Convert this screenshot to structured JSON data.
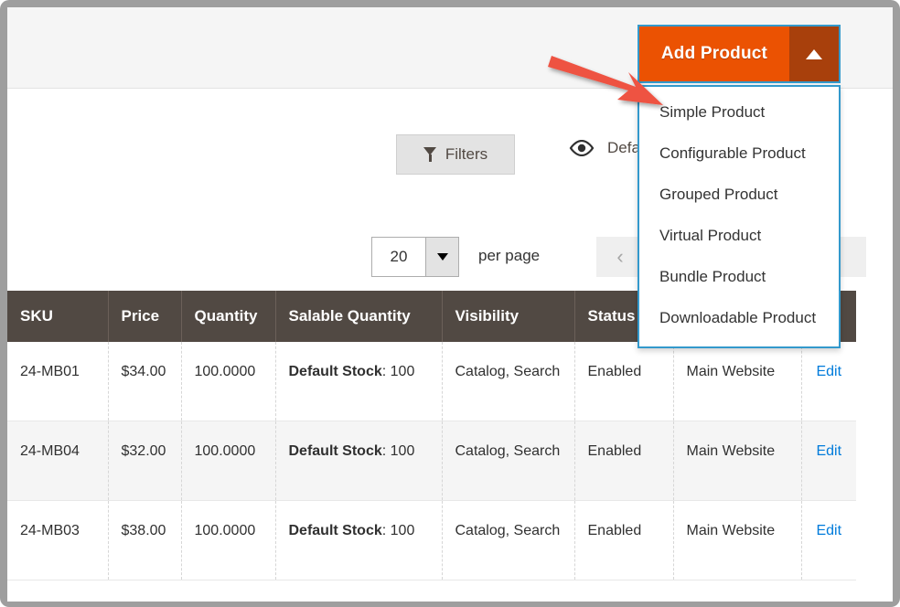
{
  "add_product": {
    "button_label": "Add Product",
    "toggle_icon": "caret-up-icon",
    "accent_color": "#eb5202",
    "toggle_color": "#a8400c",
    "focus_outline_color": "#3399cc",
    "menu_items": [
      {
        "label": "Simple Product"
      },
      {
        "label": "Configurable Product"
      },
      {
        "label": "Grouped Product"
      },
      {
        "label": "Virtual Product"
      },
      {
        "label": "Bundle Product"
      },
      {
        "label": "Downloadable Product"
      }
    ]
  },
  "toolbar": {
    "filters_label": "Filters",
    "filters_icon": "funnel-icon",
    "view_icon": "eye-icon",
    "view_label": "Default V"
  },
  "pager": {
    "per_page_value": "20",
    "per_page_label": "per page",
    "prev_label": "‹",
    "caret_icon": "chevron-down-icon"
  },
  "grid": {
    "columns": [
      "SKU",
      "Price",
      "Quantity",
      "Salable Quantity",
      "Visibility",
      "Status",
      "",
      ""
    ],
    "rows": [
      {
        "sku": "24-MB01",
        "price": "$34.00",
        "quantity": "100.0000",
        "salable_label": "Default Stock",
        "salable_value": ": 100",
        "visibility": "Catalog, Search",
        "status": "Enabled",
        "websites": "Main Website",
        "action": "Edit"
      },
      {
        "sku": "24-MB04",
        "price": "$32.00",
        "quantity": "100.0000",
        "salable_label": "Default Stock",
        "salable_value": ": 100",
        "visibility": "Catalog, Search",
        "status": "Enabled",
        "websites": "Main Website",
        "action": "Edit"
      },
      {
        "sku": "24-MB03",
        "price": "$38.00",
        "quantity": "100.0000",
        "salable_label": "Default Stock",
        "salable_value": ": 100",
        "visibility": "Catalog, Search",
        "status": "Enabled",
        "websites": "Main Website",
        "action": "Edit"
      }
    ]
  },
  "annotation": {
    "arrow_color": "#ee5243",
    "arrow_name": "red-pointer-arrow"
  }
}
